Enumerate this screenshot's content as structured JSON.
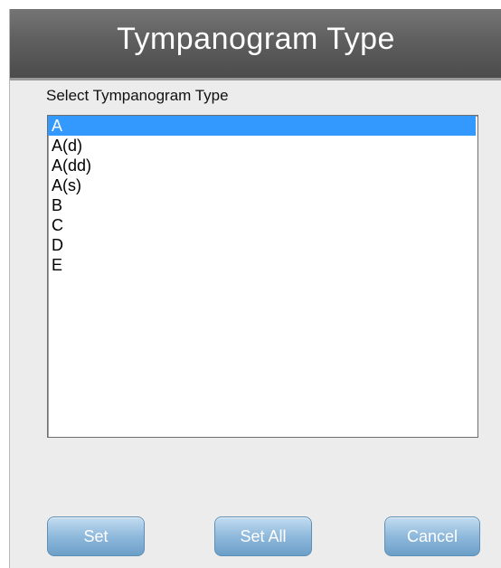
{
  "dialog": {
    "title": "Tympanogram Type",
    "list_label": "Select Tympanogram Type",
    "list": {
      "selected_index": 0,
      "items": [
        "A",
        "A(d)",
        "A(dd)",
        "A(s)",
        "B",
        "C",
        "D",
        "E"
      ]
    },
    "buttons": {
      "set": "Set",
      "set_all": "Set All",
      "cancel": "Cancel"
    }
  },
  "colors": {
    "selection": "#3399ff",
    "titlebar": "#5f5f5f",
    "button": "#8fb9dc"
  }
}
